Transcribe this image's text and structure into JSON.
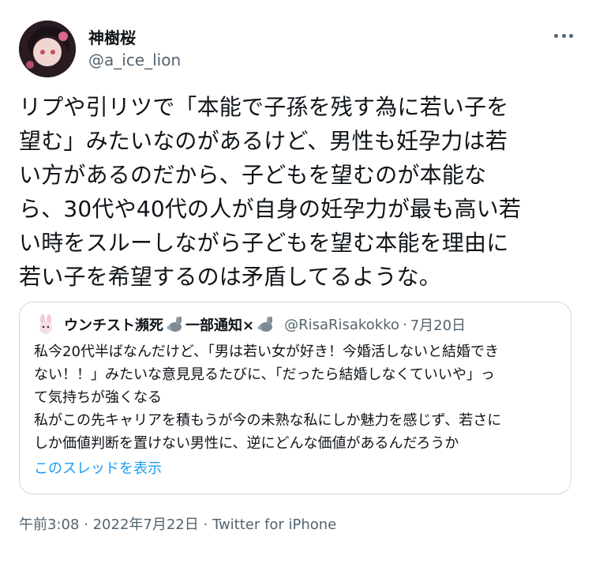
{
  "author": {
    "display_name": "神樹桜",
    "username": "@a_ice_lion"
  },
  "tweet": {
    "text": "リプや引リツで「本能で子孫を残す為に若い子を\n望む」みたいなのがあるけど、男性も妊孕力は若\nい方があるのだから、子どもを望むのが本能な\nら、30代や40代の人が自身の妊孕力が最も高い若\nい時をスルーしながら子どもを望む本能を理由に\n若い子を希望するのは矛盾してるような。"
  },
  "quoted": {
    "name_part1": "ウンチスト瀕死",
    "name_part2": "一部通知×",
    "handle": "@RisaRisakokko",
    "separator": "·",
    "date": "7月20日",
    "text": "私今20代半ばなんだけど、「男は若い女が好き！今婚活しないと結婚でき\nない！！」みたいな意見見るたびに、「だったら結婚しなくていいや」っ\nて気持ちが強くなる\n私がこの先キャリアを積もうが今の未熟な私にしか魅力を感じず、若さに\nしか価値判断を置けない男性に、逆にどんな価値があるんだろうか",
    "thread_link": "このスレッドを表示",
    "emoji_icon": "rabbit-icon"
  },
  "meta": {
    "time": "午前3:08",
    "sep1": " · ",
    "date": "2022年7月22日",
    "sep2": " · ",
    "source": "Twitter for iPhone"
  },
  "colors": {
    "link": "#1d9bf0",
    "muted": "#536471",
    "border": "#cfd9de",
    "text": "#0f1419"
  }
}
